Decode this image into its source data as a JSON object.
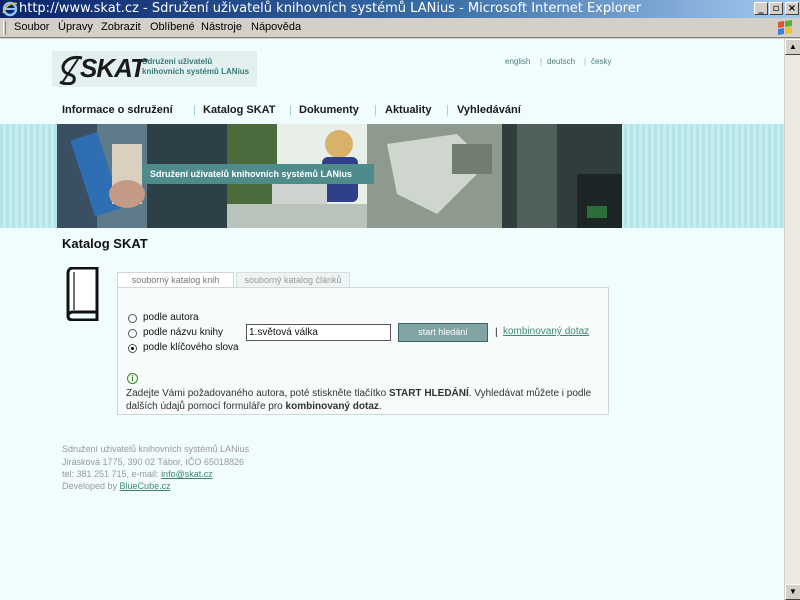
{
  "window": {
    "title": "http://www.skat.cz - Sdružení uživatelů knihovních systémů LANius - Microsoft Internet Explorer",
    "minimize": "_",
    "maximize": "▫",
    "close": "×"
  },
  "menu": [
    "Soubor",
    "Úpravy",
    "Zobrazit",
    "Oblíbené",
    "Nástroje",
    "Nápověda"
  ],
  "logo": {
    "text": "SKAT",
    "subtitle": "Sdružení uživatelů knihovních systémů LANius"
  },
  "languages": [
    "english",
    "deutsch",
    "česky"
  ],
  "nav": [
    "Informace o sdružení",
    "Katalog SKAT",
    "Dokumenty",
    "Aktuality",
    "Vyhledávání"
  ],
  "banner": {
    "caption": "Sdružení uživatelů knihovních systémů LANius"
  },
  "page": {
    "title": "Katalog SKAT"
  },
  "tabs": [
    "souborný katalog knih",
    "souborný katalog článků"
  ],
  "search": {
    "options": [
      "podle autora",
      "podle názvu knihy",
      "podle klíčového slova"
    ],
    "selected_index": 2,
    "query": "1.světová válka",
    "start_label": "start hledání",
    "separator": "|",
    "combined_link": "kombinovaný dotaz",
    "info_icon": "i",
    "help_1": "Zadejte Vámi požadovaného autora, poté stiskněte tlačítko ",
    "help_bold_1": "START HLEDÁNÍ",
    "help_2": ". Vyhledávat můžete i podle dalších údajů pomocí formuláře pro ",
    "help_bold_2": "kombinovaný dotaz",
    "help_3": "."
  },
  "footer": {
    "line1": "Sdružení uživatelů knihovních systémů LANius",
    "line2": "Jirásková 1775, 390 02 Tábor, IČO 65018826",
    "line3_prefix": "tel: 381 251 715, e-mail: ",
    "email": "info@skat.cz",
    "line4_prefix": "Developed by ",
    "developer": "BlueCube.cz"
  }
}
